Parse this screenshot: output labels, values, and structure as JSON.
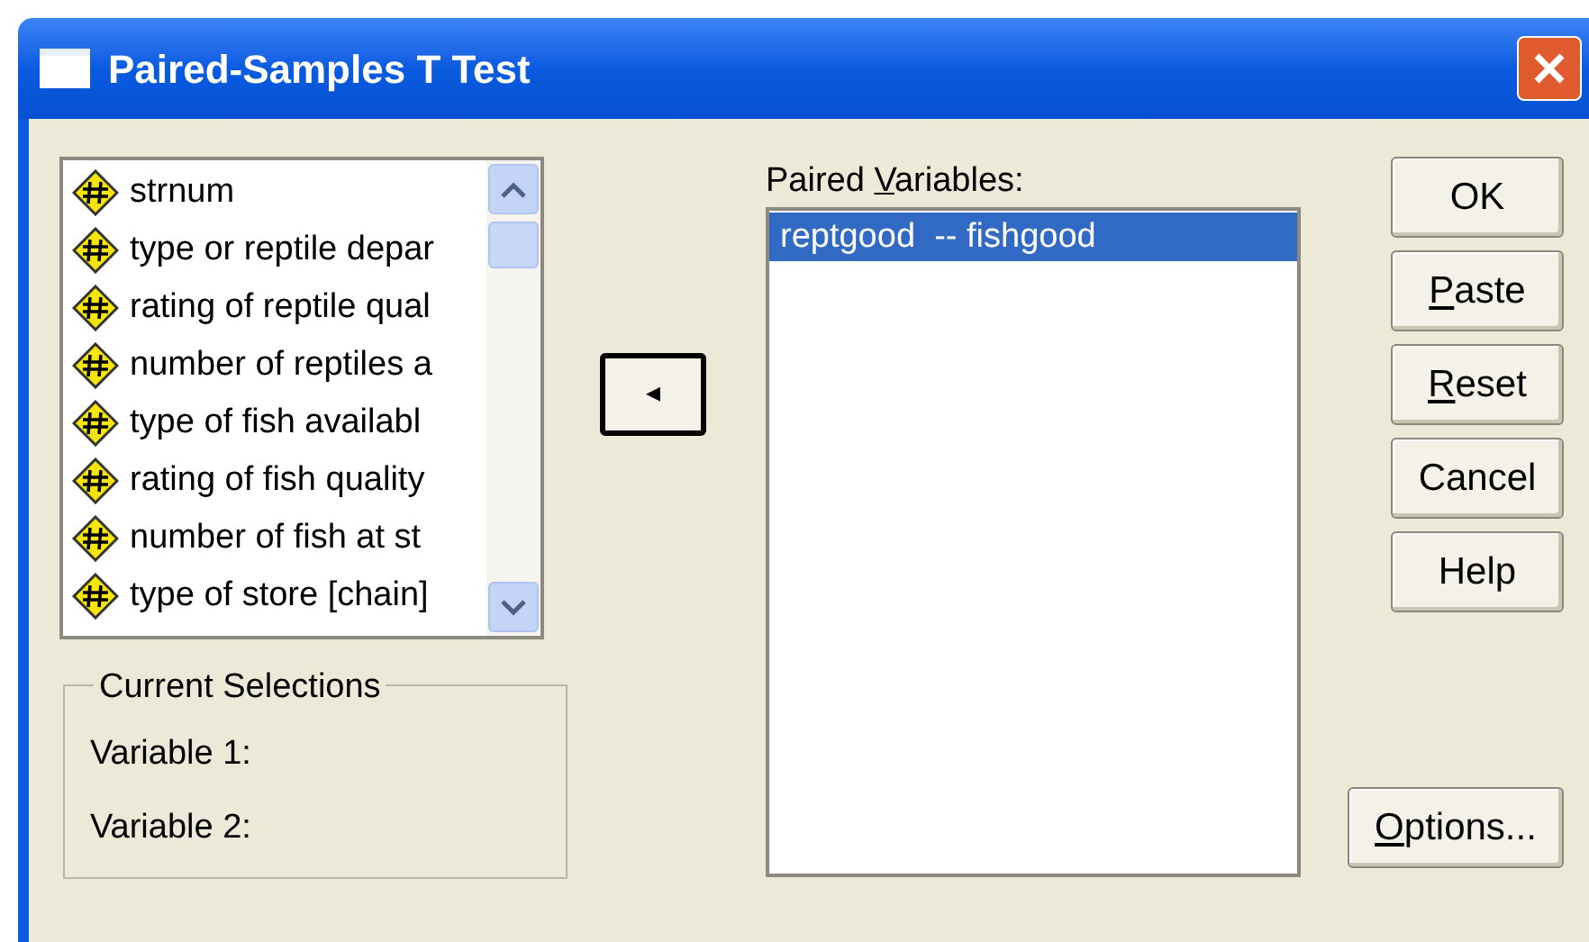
{
  "window": {
    "title": "Paired-Samples T Test"
  },
  "variables": [
    {
      "label": "strnum"
    },
    {
      "label": "type or reptile depar"
    },
    {
      "label": "rating of reptile qual"
    },
    {
      "label": "number of reptiles a"
    },
    {
      "label": "type of fish availabl"
    },
    {
      "label": "rating of fish quality"
    },
    {
      "label": "number of fish at st"
    },
    {
      "label": "type of store [chain]"
    }
  ],
  "move_button": {
    "glyph": "◂"
  },
  "paired_variables": {
    "label_parts": {
      "lead": "Paired ",
      "mnemonic": "V",
      "rest": "ariables:"
    },
    "items": [
      {
        "label": "reptgood  -- fishgood",
        "selected": true
      }
    ]
  },
  "current_selections": {
    "title": "Current Selections",
    "rows": [
      "Variable 1:",
      "Variable 2:"
    ]
  },
  "buttons": [
    {
      "label_parts": {
        "lead": "OK"
      }
    },
    {
      "label_parts": {
        "mnemonic": "P",
        "rest": "aste"
      }
    },
    {
      "label_parts": {
        "mnemonic": "R",
        "rest": "eset"
      }
    },
    {
      "label_parts": {
        "lead": "Cancel"
      }
    },
    {
      "label_parts": {
        "lead": "Help"
      }
    }
  ],
  "options_button": {
    "label_parts": {
      "mnemonic": "O",
      "rest": "ptions..."
    }
  }
}
